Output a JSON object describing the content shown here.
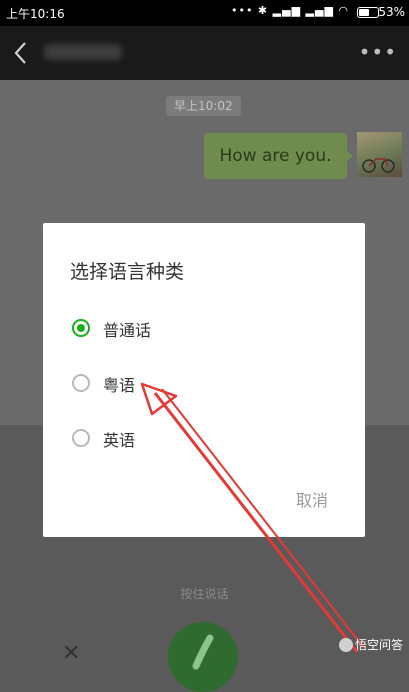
{
  "status_bar": {
    "time": "上午10:16",
    "signal_icons": "••• ✱ ▂▄▆ ▂▄▆ ◠",
    "battery_percent": "53%"
  },
  "chat": {
    "timestamp": "早上10:02",
    "message": "How are you."
  },
  "dialog": {
    "title": "选择语言种类",
    "options": [
      {
        "label": "普通话",
        "selected": true
      },
      {
        "label": "粤语",
        "selected": false
      },
      {
        "label": "英语",
        "selected": false
      }
    ],
    "cancel_label": "取消"
  },
  "bottom": {
    "hold_to_talk": "按住说话"
  },
  "watermark": "悟空问答",
  "colors": {
    "accent_green": "#1aad19",
    "arrow_red": "#e53935",
    "bubble_green": "#6f8b4d"
  },
  "icons": {
    "back": "chevron-left-icon",
    "more": "more-dots-icon",
    "mic": "microphone-icon",
    "close": "close-icon"
  }
}
